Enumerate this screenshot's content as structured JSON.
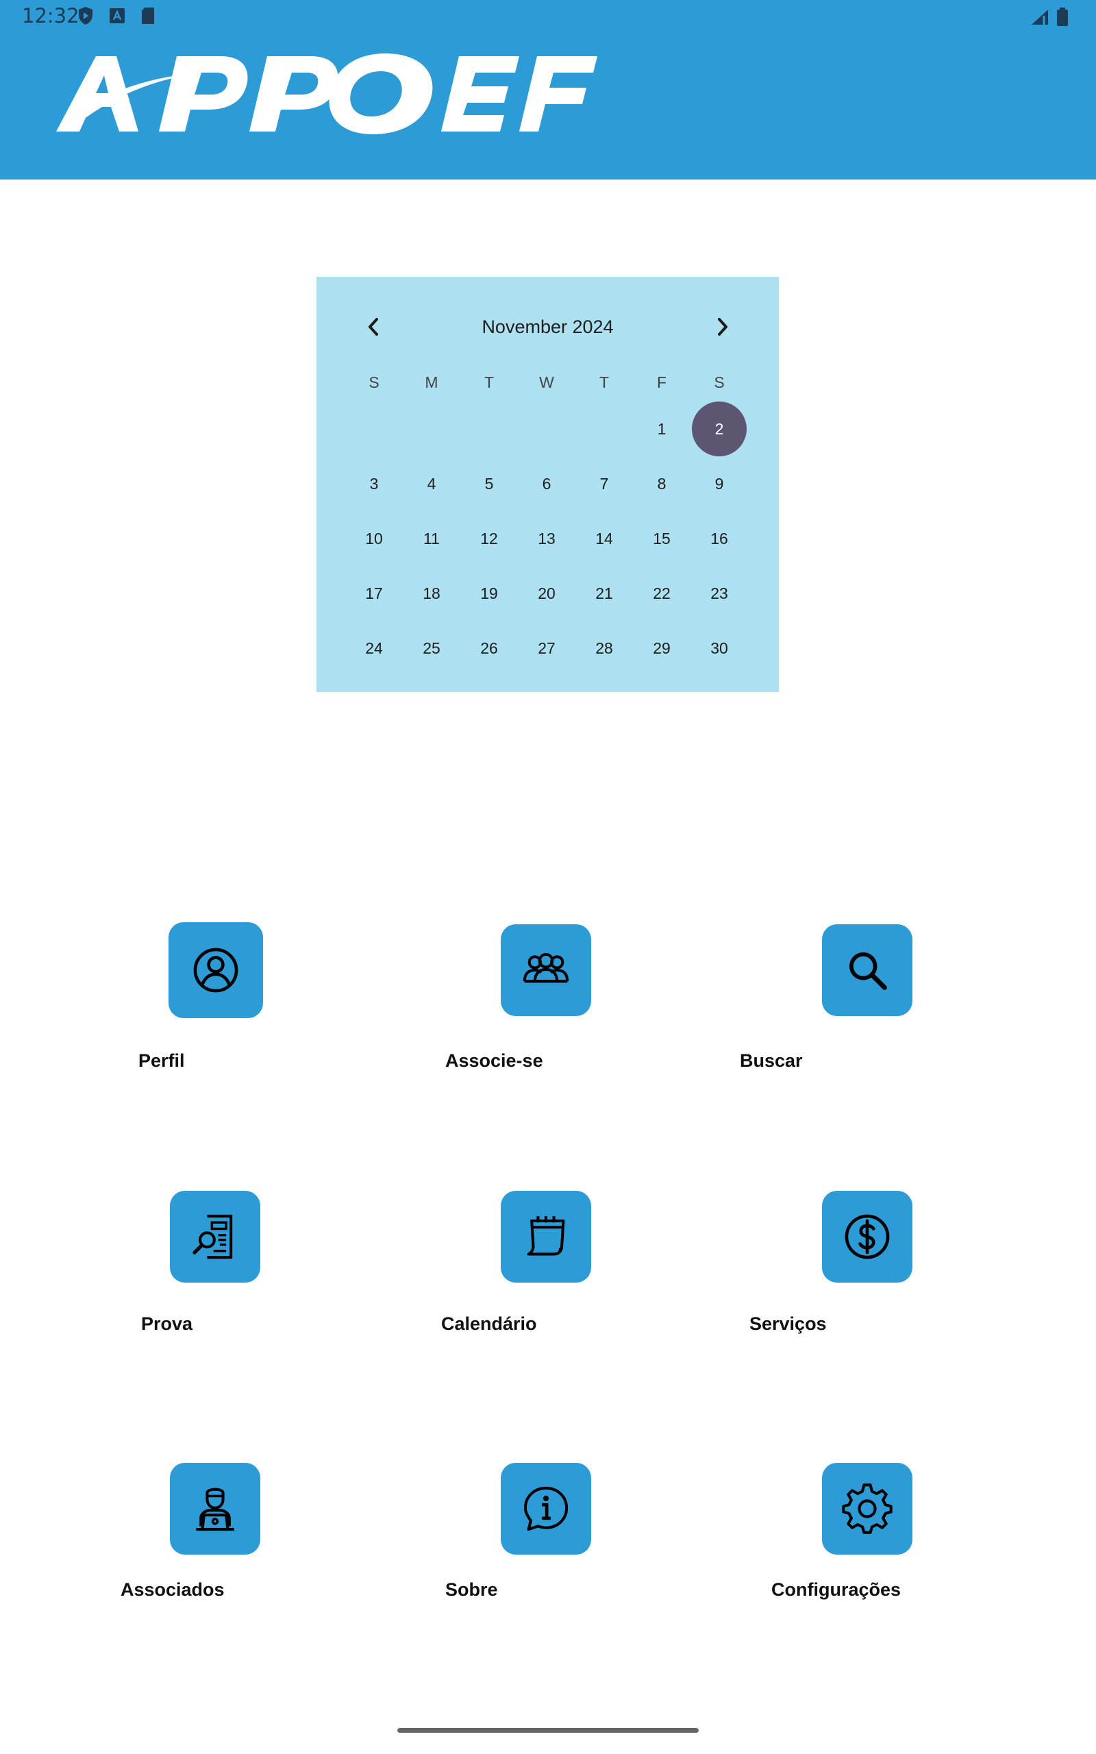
{
  "status_bar": {
    "time": "12:32",
    "left_icons": [
      "shield-play-icon",
      "font-a-icon",
      "sd-card-icon"
    ],
    "right_icons": [
      "signal-icon",
      "battery-icon"
    ]
  },
  "header": {
    "logo_text": "APPOEF",
    "background": "#2d9cd6"
  },
  "calendar": {
    "month_label": "November 2024",
    "weekdays": [
      "S",
      "M",
      "T",
      "W",
      "T",
      "F",
      "S"
    ],
    "leading_blanks": 5,
    "days": [
      "1",
      "2",
      "3",
      "4",
      "5",
      "6",
      "7",
      "8",
      "9",
      "10",
      "11",
      "12",
      "13",
      "14",
      "15",
      "16",
      "17",
      "18",
      "19",
      "20",
      "21",
      "22",
      "23",
      "24",
      "25",
      "26",
      "27",
      "28",
      "29",
      "30"
    ],
    "selected_day": "2",
    "background": "#ade0f0",
    "selected_color": "#5e5573"
  },
  "menu": {
    "items": [
      {
        "label": "Perfil",
        "icon": "user-circle-icon"
      },
      {
        "label": "Associe-se",
        "icon": "group-icon"
      },
      {
        "label": "Buscar",
        "icon": "search-icon"
      },
      {
        "label": "Prova",
        "icon": "document-search-icon"
      },
      {
        "label": "Calendário",
        "icon": "calendar-icon"
      },
      {
        "label": "Serviços",
        "icon": "dollar-circle-icon"
      },
      {
        "label": "Associados",
        "icon": "person-laptop-icon"
      },
      {
        "label": "Sobre",
        "icon": "info-chat-icon"
      },
      {
        "label": "Configurações",
        "icon": "gear-icon"
      }
    ],
    "tile_color": "#2d9cd6"
  }
}
